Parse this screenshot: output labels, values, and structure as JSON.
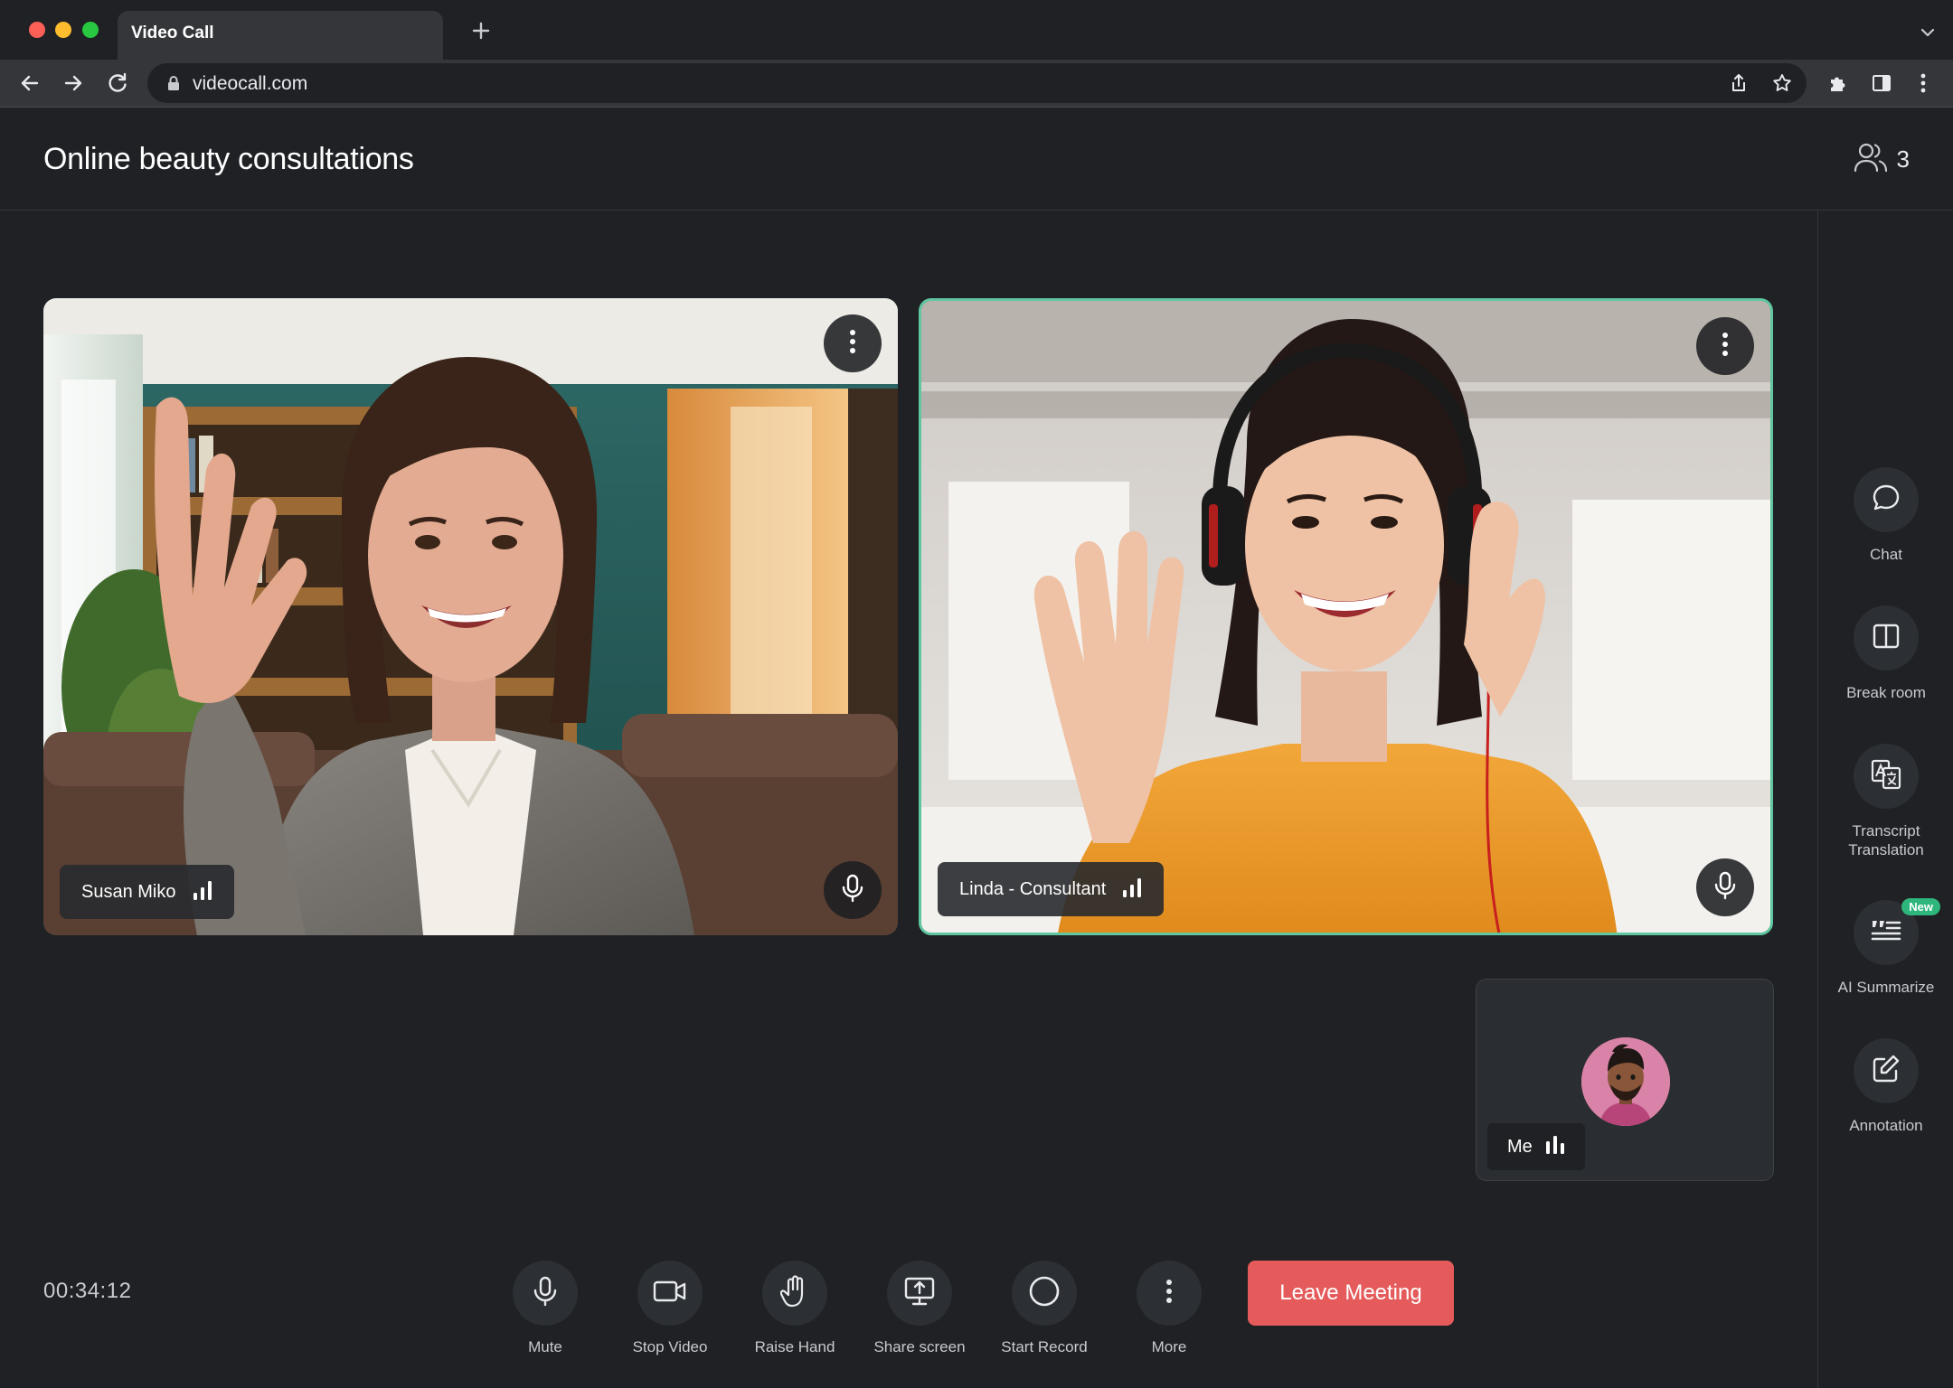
{
  "browser": {
    "tab_title": "Video Call",
    "url": "videocall.com"
  },
  "header": {
    "title": "Online beauty consultations",
    "participant_count": "3"
  },
  "participants": [
    {
      "name": "Susan Miko"
    },
    {
      "name": "Linda - Consultant"
    }
  ],
  "self": {
    "label": "Me"
  },
  "sidebar": {
    "items": [
      {
        "label": "Chat",
        "icon": "chat-icon"
      },
      {
        "label": "Break room",
        "icon": "break-room-icon"
      },
      {
        "label": "Transcript\nTranslation",
        "icon": "translate-icon"
      },
      {
        "label": "AI Summarize",
        "icon": "summarize-icon",
        "badge": "New"
      },
      {
        "label": "Annotation",
        "icon": "annotation-icon"
      }
    ]
  },
  "controls": {
    "timer": "00:34:12",
    "items": [
      {
        "label": "Mute",
        "icon": "microphone-icon"
      },
      {
        "label": "Stop Video",
        "icon": "video-camera-icon"
      },
      {
        "label": "Raise Hand",
        "icon": "hand-icon"
      },
      {
        "label": "Share screen",
        "icon": "share-screen-icon"
      },
      {
        "label": "Start Record",
        "icon": "record-icon"
      },
      {
        "label": "More",
        "icon": "more-vertical-icon"
      }
    ],
    "leave_label": "Leave Meeting"
  },
  "colors": {
    "background": "#1f2124",
    "active_speaker_border": "#5ec7a0",
    "leave_button": "#e55a5a",
    "new_badge": "#2fb67c"
  }
}
